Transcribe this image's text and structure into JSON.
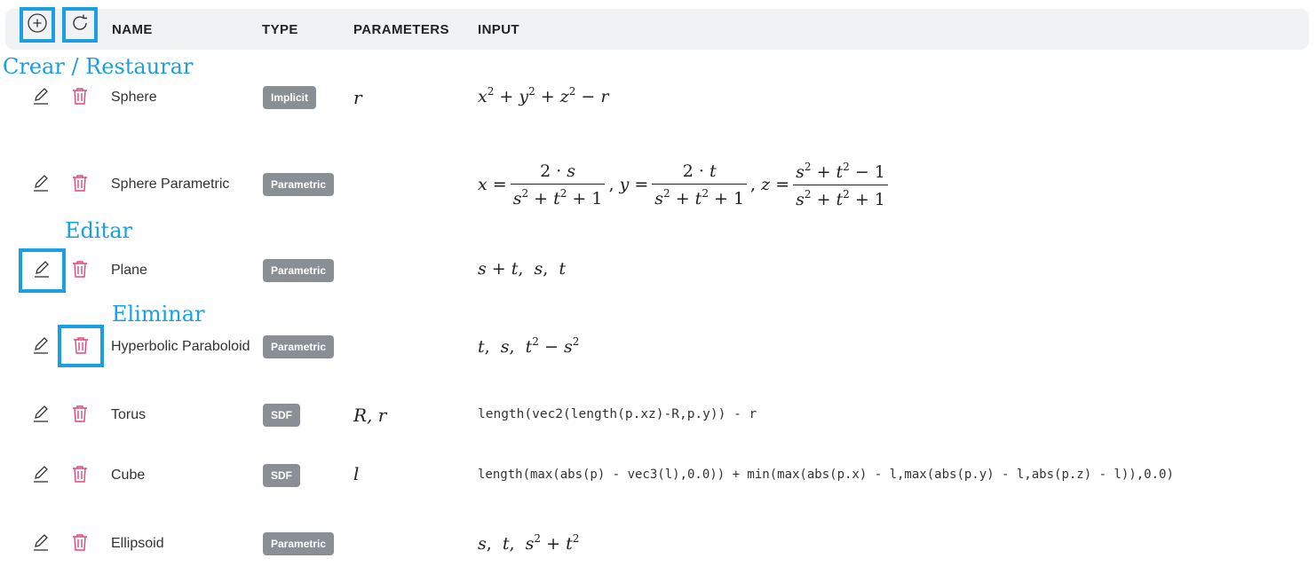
{
  "header": {
    "columns": {
      "name": "NAME",
      "type": "TYPE",
      "parameters": "PARAMETERS",
      "input": "INPUT"
    }
  },
  "annotations": {
    "create_restore": "Crear / Restaurar",
    "edit": "Editar",
    "delete": "Eliminar"
  },
  "colors": {
    "highlight": "#1a9fe0",
    "badge": "#8a8f96",
    "delete_icon": "#e2467a"
  },
  "icons": {
    "add": "plus-circle-icon",
    "restore": "refresh-icon",
    "edit": "pencil-icon",
    "delete": "trash-icon"
  },
  "rows": [
    {
      "name": "Sphere",
      "type": "Implicit",
      "parameters": "r",
      "input": "x^2 + y^2 + z^2 − r"
    },
    {
      "name": "Sphere Parametric",
      "type": "Parametric",
      "parameters": "",
      "input": "x = 2·s/(s^2+t^2+1), y = 2·t/(s^2+t^2+1), z = (s^2+t^2−1)/(s^2+t^2+1)"
    },
    {
      "name": "Plane",
      "type": "Parametric",
      "parameters": "",
      "input": "s + t, s, t"
    },
    {
      "name": "Hyperbolic Paraboloid",
      "type": "Parametric",
      "parameters": "",
      "input": "t, s, t^2 − s^2"
    },
    {
      "name": "Torus",
      "type": "SDF",
      "parameters": "R, r",
      "input": "length(vec2(length(p.xz)-R,p.y)) - r"
    },
    {
      "name": "Cube",
      "type": "SDF",
      "parameters": "l",
      "input": "length(max(abs(p) - vec3(l),0.0)) + min(max(abs(p.x) - l,max(abs(p.y) - l,abs(p.z) - l)),0.0)"
    },
    {
      "name": "Ellipsoid",
      "type": "Parametric",
      "parameters": "",
      "input": "s, t, s^2 + t^2"
    }
  ]
}
